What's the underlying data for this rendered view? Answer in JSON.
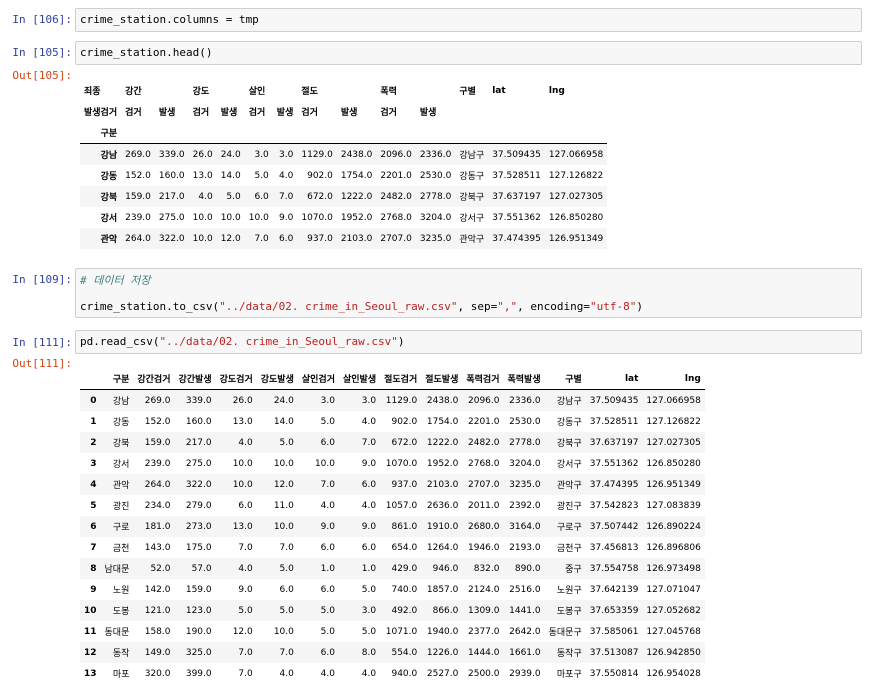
{
  "cells": [
    {
      "prompt": "In [106]:",
      "code": "crime_station.columns = tmp"
    },
    {
      "prompt": "In [105]:",
      "code": "crime_station.head()",
      "out_prompt": "Out[105]:"
    },
    {
      "prompt": "In [109]:",
      "comment": "# 데이터 저장",
      "code_prefix": "crime_station.to_csv(",
      "code_path": "\"../data/02. crime_in_Seoul_raw.csv\"",
      "code_mid": ", sep=",
      "code_sep": "\",\"",
      "code_mid2": ", encoding=",
      "code_enc": "\"utf-8\"",
      "code_end": ")"
    },
    {
      "prompt": "In [111]:",
      "code_prefix": "pd.read_csv(",
      "code_path": "\"../data/02. crime_in_Seoul_raw.csv\"",
      "code_end": ")",
      "out_prompt": "Out[111]:"
    }
  ],
  "head_table": {
    "header_top": [
      "죄종",
      "강간",
      "",
      "강도",
      "",
      "살인",
      "",
      "절도",
      "",
      "폭력",
      "",
      "구별",
      "lat",
      "lng"
    ],
    "header_mid": [
      "발생검거",
      "검거",
      "발생",
      "검거",
      "발생",
      "검거",
      "발생",
      "검거",
      "발생",
      "검거",
      "발생",
      "",
      "",
      ""
    ],
    "index_name": "구분",
    "rows": [
      {
        "idx": "강남",
        "vals": [
          "269.0",
          "339.0",
          "26.0",
          "24.0",
          "3.0",
          "3.0",
          "1129.0",
          "2438.0",
          "2096.0",
          "2336.0",
          "강남구",
          "37.509435",
          "127.066958"
        ]
      },
      {
        "idx": "강동",
        "vals": [
          "152.0",
          "160.0",
          "13.0",
          "14.0",
          "5.0",
          "4.0",
          "902.0",
          "1754.0",
          "2201.0",
          "2530.0",
          "강동구",
          "37.528511",
          "127.126822"
        ]
      },
      {
        "idx": "강북",
        "vals": [
          "159.0",
          "217.0",
          "4.0",
          "5.0",
          "6.0",
          "7.0",
          "672.0",
          "1222.0",
          "2482.0",
          "2778.0",
          "강북구",
          "37.637197",
          "127.027305"
        ]
      },
      {
        "idx": "강서",
        "vals": [
          "239.0",
          "275.0",
          "10.0",
          "10.0",
          "10.0",
          "9.0",
          "1070.0",
          "1952.0",
          "2768.0",
          "3204.0",
          "강서구",
          "37.551362",
          "126.850280"
        ]
      },
      {
        "idx": "관악",
        "vals": [
          "264.0",
          "322.0",
          "10.0",
          "12.0",
          "7.0",
          "6.0",
          "937.0",
          "2103.0",
          "2707.0",
          "3235.0",
          "관악구",
          "37.474395",
          "126.951349"
        ]
      }
    ]
  },
  "csv_table": {
    "columns": [
      "구분",
      "강간검거",
      "강간발생",
      "강도검거",
      "강도발생",
      "살인검거",
      "살인발생",
      "절도검거",
      "절도발생",
      "폭력검거",
      "폭력발생",
      "구별",
      "lat",
      "lng"
    ],
    "rows": [
      {
        "idx": "0",
        "vals": [
          "강남",
          "269.0",
          "339.0",
          "26.0",
          "24.0",
          "3.0",
          "3.0",
          "1129.0",
          "2438.0",
          "2096.0",
          "2336.0",
          "강남구",
          "37.509435",
          "127.066958"
        ]
      },
      {
        "idx": "1",
        "vals": [
          "강동",
          "152.0",
          "160.0",
          "13.0",
          "14.0",
          "5.0",
          "4.0",
          "902.0",
          "1754.0",
          "2201.0",
          "2530.0",
          "강동구",
          "37.528511",
          "127.126822"
        ]
      },
      {
        "idx": "2",
        "vals": [
          "강북",
          "159.0",
          "217.0",
          "4.0",
          "5.0",
          "6.0",
          "7.0",
          "672.0",
          "1222.0",
          "2482.0",
          "2778.0",
          "강북구",
          "37.637197",
          "127.027305"
        ]
      },
      {
        "idx": "3",
        "vals": [
          "강서",
          "239.0",
          "275.0",
          "10.0",
          "10.0",
          "10.0",
          "9.0",
          "1070.0",
          "1952.0",
          "2768.0",
          "3204.0",
          "강서구",
          "37.551362",
          "126.850280"
        ]
      },
      {
        "idx": "4",
        "vals": [
          "관악",
          "264.0",
          "322.0",
          "10.0",
          "12.0",
          "7.0",
          "6.0",
          "937.0",
          "2103.0",
          "2707.0",
          "3235.0",
          "관악구",
          "37.474395",
          "126.951349"
        ]
      },
      {
        "idx": "5",
        "vals": [
          "광진",
          "234.0",
          "279.0",
          "6.0",
          "11.0",
          "4.0",
          "4.0",
          "1057.0",
          "2636.0",
          "2011.0",
          "2392.0",
          "광진구",
          "37.542823",
          "127.083839"
        ]
      },
      {
        "idx": "6",
        "vals": [
          "구로",
          "181.0",
          "273.0",
          "13.0",
          "10.0",
          "9.0",
          "9.0",
          "861.0",
          "1910.0",
          "2680.0",
          "3164.0",
          "구로구",
          "37.507442",
          "126.890224"
        ]
      },
      {
        "idx": "7",
        "vals": [
          "금천",
          "143.0",
          "175.0",
          "7.0",
          "7.0",
          "6.0",
          "6.0",
          "654.0",
          "1264.0",
          "1946.0",
          "2193.0",
          "금천구",
          "37.456813",
          "126.896806"
        ]
      },
      {
        "idx": "8",
        "vals": [
          "남대문",
          "52.0",
          "57.0",
          "4.0",
          "5.0",
          "1.0",
          "1.0",
          "429.0",
          "946.0",
          "832.0",
          "890.0",
          "중구",
          "37.554758",
          "126.973498"
        ]
      },
      {
        "idx": "9",
        "vals": [
          "노원",
          "142.0",
          "159.0",
          "9.0",
          "6.0",
          "6.0",
          "5.0",
          "740.0",
          "1857.0",
          "2124.0",
          "2516.0",
          "노원구",
          "37.642139",
          "127.071047"
        ]
      },
      {
        "idx": "10",
        "vals": [
          "도봉",
          "121.0",
          "123.0",
          "5.0",
          "5.0",
          "5.0",
          "3.0",
          "492.0",
          "866.0",
          "1309.0",
          "1441.0",
          "도봉구",
          "37.653359",
          "127.052682"
        ]
      },
      {
        "idx": "11",
        "vals": [
          "동대문",
          "158.0",
          "190.0",
          "12.0",
          "10.0",
          "5.0",
          "5.0",
          "1071.0",
          "1940.0",
          "2377.0",
          "2642.0",
          "동대문구",
          "37.585061",
          "127.045768"
        ]
      },
      {
        "idx": "12",
        "vals": [
          "동작",
          "149.0",
          "325.0",
          "7.0",
          "7.0",
          "6.0",
          "8.0",
          "554.0",
          "1226.0",
          "1444.0",
          "1661.0",
          "동작구",
          "37.513087",
          "126.942850"
        ]
      },
      {
        "idx": "13",
        "vals": [
          "마포",
          "320.0",
          "399.0",
          "7.0",
          "4.0",
          "4.0",
          "4.0",
          "940.0",
          "2527.0",
          "2500.0",
          "2939.0",
          "마포구",
          "37.550814",
          "126.954028"
        ]
      }
    ]
  }
}
